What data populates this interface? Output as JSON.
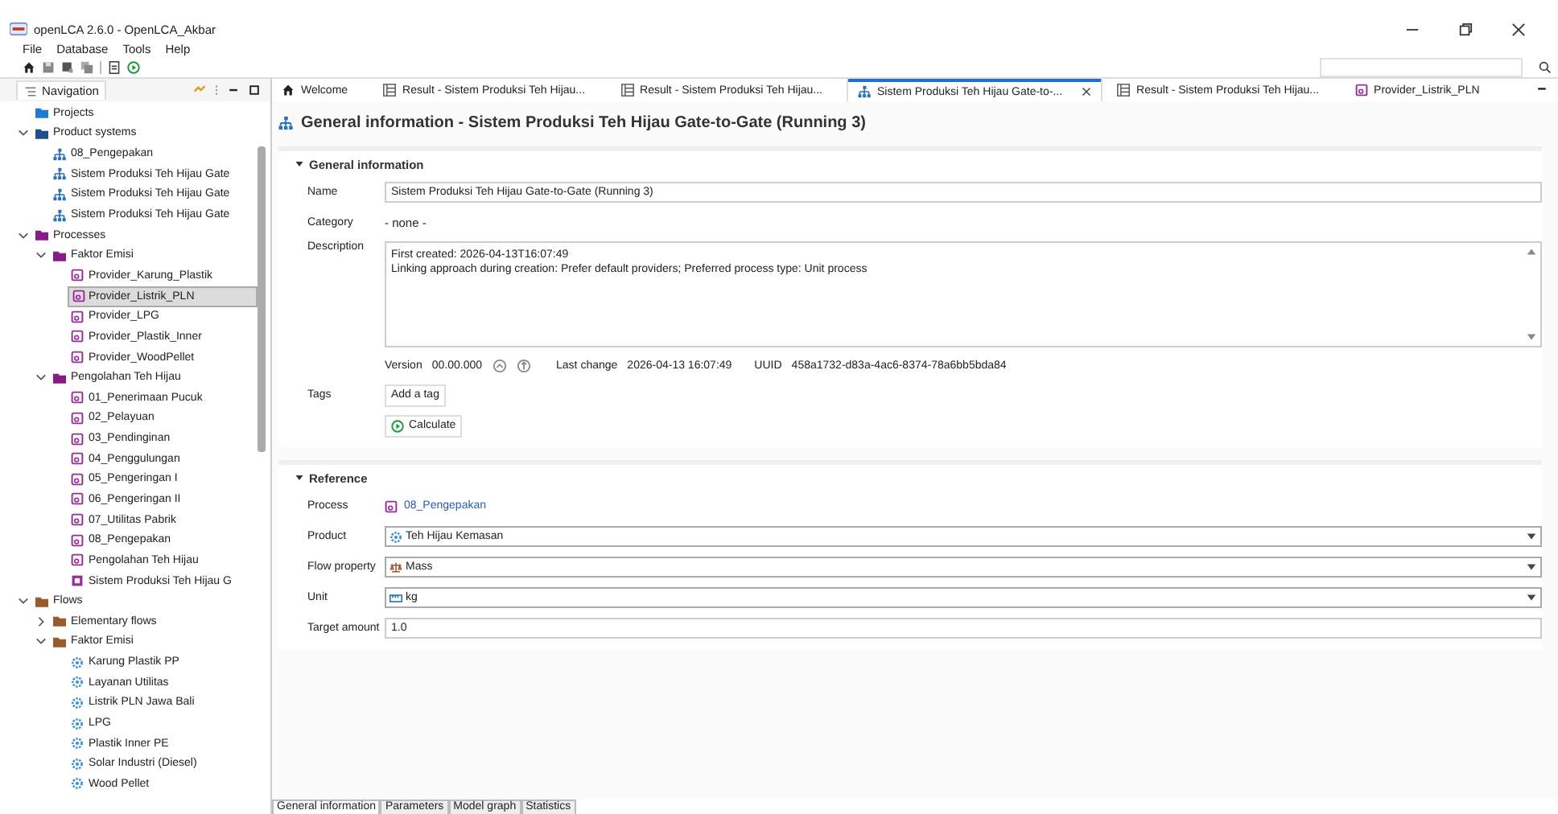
{
  "window": {
    "title": "openLCA 2.6.0 - OpenLCA_Akbar"
  },
  "menu": [
    "File",
    "Database",
    "Tools",
    "Help"
  ],
  "navigation": {
    "title": "Navigation",
    "tree": [
      {
        "label": "Projects",
        "kind": "folder",
        "color": "#1e7bd6"
      },
      {
        "label": "Product systems",
        "kind": "folder",
        "color": "#1f4e8c",
        "expanded": true,
        "children": [
          {
            "label": "08_Pengepakan",
            "kind": "system"
          },
          {
            "label": "Sistem Produksi Teh Hijau Gate",
            "kind": "system"
          },
          {
            "label": "Sistem Produksi Teh Hijau Gate",
            "kind": "system"
          },
          {
            "label": "Sistem Produksi Teh Hijau Gate",
            "kind": "system"
          }
        ]
      },
      {
        "label": "Processes",
        "kind": "folder",
        "color": "#8a1a8a",
        "expanded": true,
        "children": [
          {
            "label": "Faktor Emisi",
            "kind": "folder",
            "color": "#8a1a8a",
            "expanded": true,
            "children": [
              {
                "label": "Provider_Karung_Plastik",
                "kind": "process",
                "selected": false
              },
              {
                "label": "Provider_Listrik_PLN",
                "kind": "process",
                "selected": true
              },
              {
                "label": "Provider_LPG",
                "kind": "process",
                "selected": false
              },
              {
                "label": "Provider_Plastik_Inner",
                "kind": "process",
                "selected": false
              },
              {
                "label": "Provider_WoodPellet",
                "kind": "process",
                "selected": false
              }
            ]
          },
          {
            "label": "Pengolahan Teh Hijau",
            "kind": "folder",
            "color": "#8a1a8a",
            "expanded": true,
            "children": [
              {
                "label": "01_Penerimaan Pucuk",
                "kind": "process",
                "selected": false
              },
              {
                "label": "02_Pelayuan",
                "kind": "process",
                "selected": false
              },
              {
                "label": "03_Pendinginan",
                "kind": "process",
                "selected": false
              },
              {
                "label": "04_Penggulungan",
                "kind": "process",
                "selected": false
              },
              {
                "label": "05_Pengeringan I",
                "kind": "process",
                "selected": false
              },
              {
                "label": "06_Pengeringan II",
                "kind": "process",
                "selected": false
              },
              {
                "label": "07_Utilitas Pabrik",
                "kind": "process",
                "selected": false
              },
              {
                "label": "08_Pengepakan",
                "kind": "process",
                "selected": false
              },
              {
                "label": "Pengolahan Teh Hijau",
                "kind": "process",
                "selected": false
              },
              {
                "label": "Sistem Produksi Teh Hijau G",
                "kind": "system-process",
                "selected": false
              }
            ]
          }
        ]
      },
      {
        "label": "Flows",
        "kind": "folder",
        "color": "#9a5a2a",
        "expanded": true,
        "children": [
          {
            "label": "Elementary flows",
            "kind": "folder",
            "color": "#9a5a2a",
            "expanded": false
          },
          {
            "label": "Faktor Emisi",
            "kind": "folder",
            "color": "#9a5a2a",
            "expanded": true,
            "children": [
              {
                "label": "Karung Plastik PP",
                "kind": "flow"
              },
              {
                "label": "Layanan Utilitas",
                "kind": "flow"
              },
              {
                "label": "Listrik PLN Jawa Bali",
                "kind": "flow"
              },
              {
                "label": "LPG",
                "kind": "flow"
              },
              {
                "label": "Plastik Inner PE",
                "kind": "flow"
              },
              {
                "label": "Solar Industri (Diesel)",
                "kind": "flow"
              },
              {
                "label": "Wood Pellet",
                "kind": "flow"
              }
            ]
          }
        ]
      }
    ]
  },
  "tabs": [
    {
      "label": "Welcome",
      "kind": "home",
      "selected": false
    },
    {
      "label": "Result - Sistem Produksi Teh Hijau...",
      "kind": "result",
      "selected": false
    },
    {
      "label": "Result - Sistem Produksi Teh Hijau...",
      "kind": "result",
      "selected": false
    },
    {
      "label": "Sistem Produksi Teh Hijau Gate-to-...",
      "kind": "system",
      "selected": true
    },
    {
      "label": "Result - Sistem Produksi Teh Hijau...",
      "kind": "result",
      "selected": false
    },
    {
      "label": "Provider_Listrik_PLN",
      "kind": "process",
      "selected": false
    }
  ],
  "editor": {
    "title": "General information - Sistem Produksi Teh Hijau Gate-to-Gate (Running 3)",
    "general": {
      "heading": "General information",
      "name_label": "Name",
      "name": "Sistem Produksi Teh Hijau Gate-to-Gate (Running 3)",
      "category_label": "Category",
      "category": "- none -",
      "description_label": "Description",
      "description": [
        "First created: 2026-04-13T16:07:49",
        "Linking approach during creation: Prefer default providers; Preferred process type: Unit process"
      ],
      "version_label": "Version",
      "version": "00.00.000",
      "last_change_label": "Last change",
      "last_change": "2026-04-13 16:07:49",
      "uuid_label": "UUID",
      "uuid": "458a1732-d83a-4ac6-8374-78a6bb5bda84",
      "tags_label": "Tags",
      "add_tag": "Add a tag",
      "calculate": "Calculate"
    },
    "reference": {
      "heading": "Reference",
      "process_label": "Process",
      "process": "08_Pengepakan",
      "selects": [
        {
          "label": "Product",
          "value": "Teh Hijau Kemasan",
          "kind": "flow"
        },
        {
          "label": "Flow property",
          "value": "Mass",
          "kind": "property"
        },
        {
          "label": "Unit",
          "value": "kg",
          "kind": "unit"
        }
      ],
      "target_label": "Target amount",
      "target": "1.0"
    }
  },
  "bottom_tabs": [
    {
      "label": "General information",
      "selected": true
    },
    {
      "label": "Parameters",
      "selected": false
    },
    {
      "label": "Model graph",
      "selected": false
    },
    {
      "label": "Statistics",
      "selected": false
    }
  ]
}
